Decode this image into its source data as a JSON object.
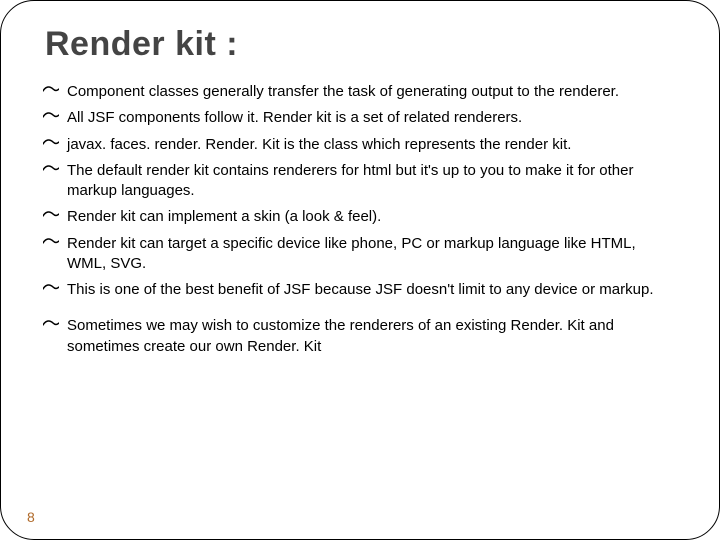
{
  "title": "Render kit :",
  "bullets_a": [
    "Component classes generally transfer the task of generating output to the renderer.",
    "All JSF components follow it. Render kit is a set of related renderers.",
    "javax. faces. render. Render. Kit is the class which represents the render kit.",
    "The default render kit contains renderers for html but it's up to you to make it for other markup languages.",
    "Render kit can implement a skin (a look & feel).",
    "Render kit can target a specific device like phone, PC or markup language like HTML, WML, SVG.",
    "This is one of the best benefit of  JSF because JSF doesn't limit to any device or markup."
  ],
  "bullets_b": [
    "Sometimes we may wish to customize the renderers of an existing Render. Kit and sometimes create our own Render. Kit"
  ],
  "page_number": "8"
}
